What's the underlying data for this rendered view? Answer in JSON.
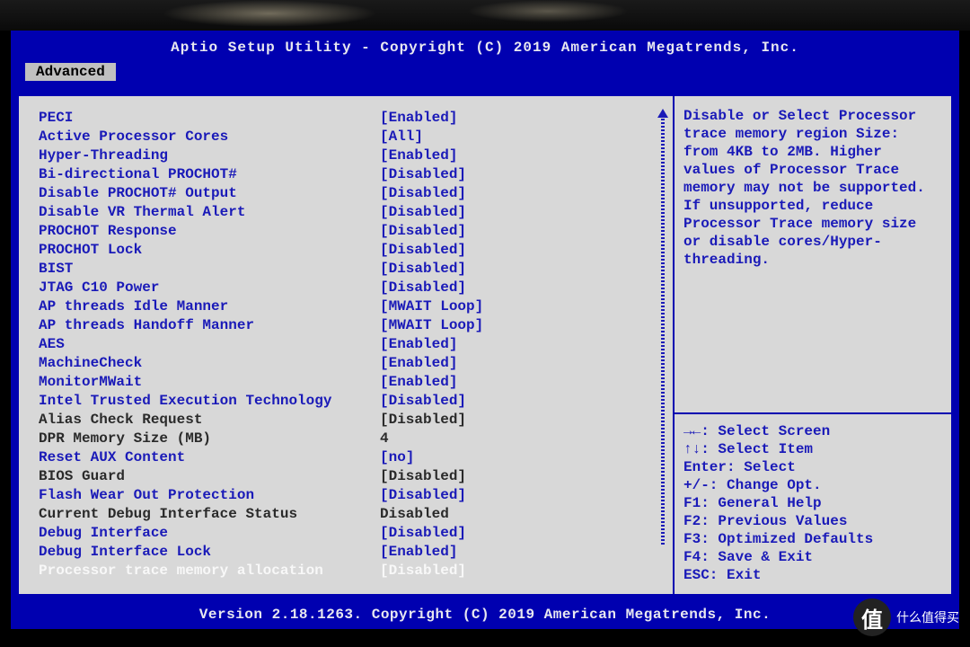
{
  "header": {
    "title": "Aptio Setup Utility - Copyright (C) 2019 American Megatrends, Inc.",
    "active_tab": "Advanced"
  },
  "settings": [
    {
      "label": "PECI",
      "value": "[Enabled]",
      "editable": true
    },
    {
      "label": "Active Processor Cores",
      "value": "[All]",
      "editable": true
    },
    {
      "label": "Hyper-Threading",
      "value": "[Enabled]",
      "editable": true
    },
    {
      "label": "Bi-directional PROCHOT#",
      "value": "[Disabled]",
      "editable": true
    },
    {
      "label": "Disable PROCHOT# Output",
      "value": "[Disabled]",
      "editable": true
    },
    {
      "label": "Disable VR Thermal Alert",
      "value": "[Disabled]",
      "editable": true
    },
    {
      "label": "PROCHOT Response",
      "value": "[Disabled]",
      "editable": true
    },
    {
      "label": "PROCHOT Lock",
      "value": "[Disabled]",
      "editable": true
    },
    {
      "label": "BIST",
      "value": "[Disabled]",
      "editable": true
    },
    {
      "label": "JTAG C10 Power",
      "value": "[Disabled]",
      "editable": true
    },
    {
      "label": "AP threads Idle Manner",
      "value": "[MWAIT Loop]",
      "editable": true
    },
    {
      "label": "AP threads Handoff Manner",
      "value": "[MWAIT Loop]",
      "editable": true
    },
    {
      "label": "AES",
      "value": "[Enabled]",
      "editable": true
    },
    {
      "label": "MachineCheck",
      "value": "[Enabled]",
      "editable": true
    },
    {
      "label": "MonitorMWait",
      "value": "[Enabled]",
      "editable": true
    },
    {
      "label": "Intel Trusted Execution Technology",
      "value": "[Disabled]",
      "editable": true
    },
    {
      "label": "Alias Check Request",
      "value": "[Disabled]",
      "editable": false
    },
    {
      "label": "DPR Memory Size (MB)",
      "value": "4",
      "editable": false
    },
    {
      "label": "Reset AUX Content",
      "value": "[no]",
      "editable": true
    },
    {
      "label": "BIOS Guard",
      "value": "[Disabled]",
      "editable": false
    },
    {
      "label": "Flash Wear Out Protection",
      "value": "[Disabled]",
      "editable": true
    },
    {
      "label": "Current Debug Interface Status",
      "value": "Disabled",
      "editable": false
    },
    {
      "label": "Debug Interface",
      "value": "[Disabled]",
      "editable": true
    },
    {
      "label": "Debug Interface Lock",
      "value": "[Enabled]",
      "editable": true
    },
    {
      "label": "Processor trace memory allocation",
      "value": "[Disabled]",
      "editable": true,
      "selected": true
    }
  ],
  "help_text": "Disable or Select Processor trace memory region Size: from 4KB to 2MB. Higher values of Processor Trace memory may not be supported. If unsupported, reduce Processor Trace memory size or disable cores/Hyper-threading.",
  "keys": [
    "→←: Select Screen",
    "↑↓: Select Item",
    "Enter: Select",
    "+/-: Change Opt.",
    "F1: General Help",
    "F2: Previous Values",
    "F3: Optimized Defaults",
    "F4: Save & Exit",
    "ESC: Exit"
  ],
  "footer": "Version 2.18.1263. Copyright (C) 2019 American Megatrends, Inc.",
  "watermark": "什么值得买"
}
